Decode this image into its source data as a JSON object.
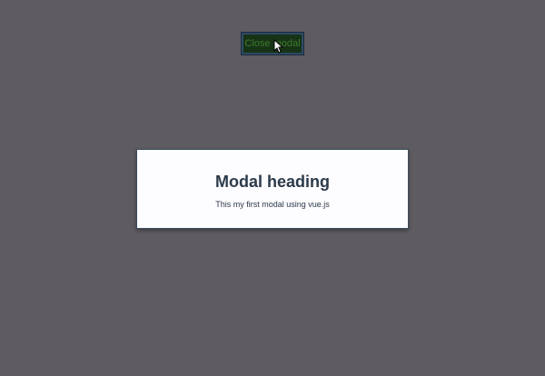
{
  "toolbar": {
    "close_modal_label": "Close modal"
  },
  "modal": {
    "heading": "Modal heading",
    "body": "This my first modal using vue.js"
  },
  "colors": {
    "backdrop": "#5e5c60",
    "button_bg": "#173316",
    "button_text": "#3f7a2c",
    "modal_bg": "#fdfcff",
    "modal_text": "#2b3a4a"
  },
  "icons": {
    "cursor": "mouse-pointer-icon"
  }
}
